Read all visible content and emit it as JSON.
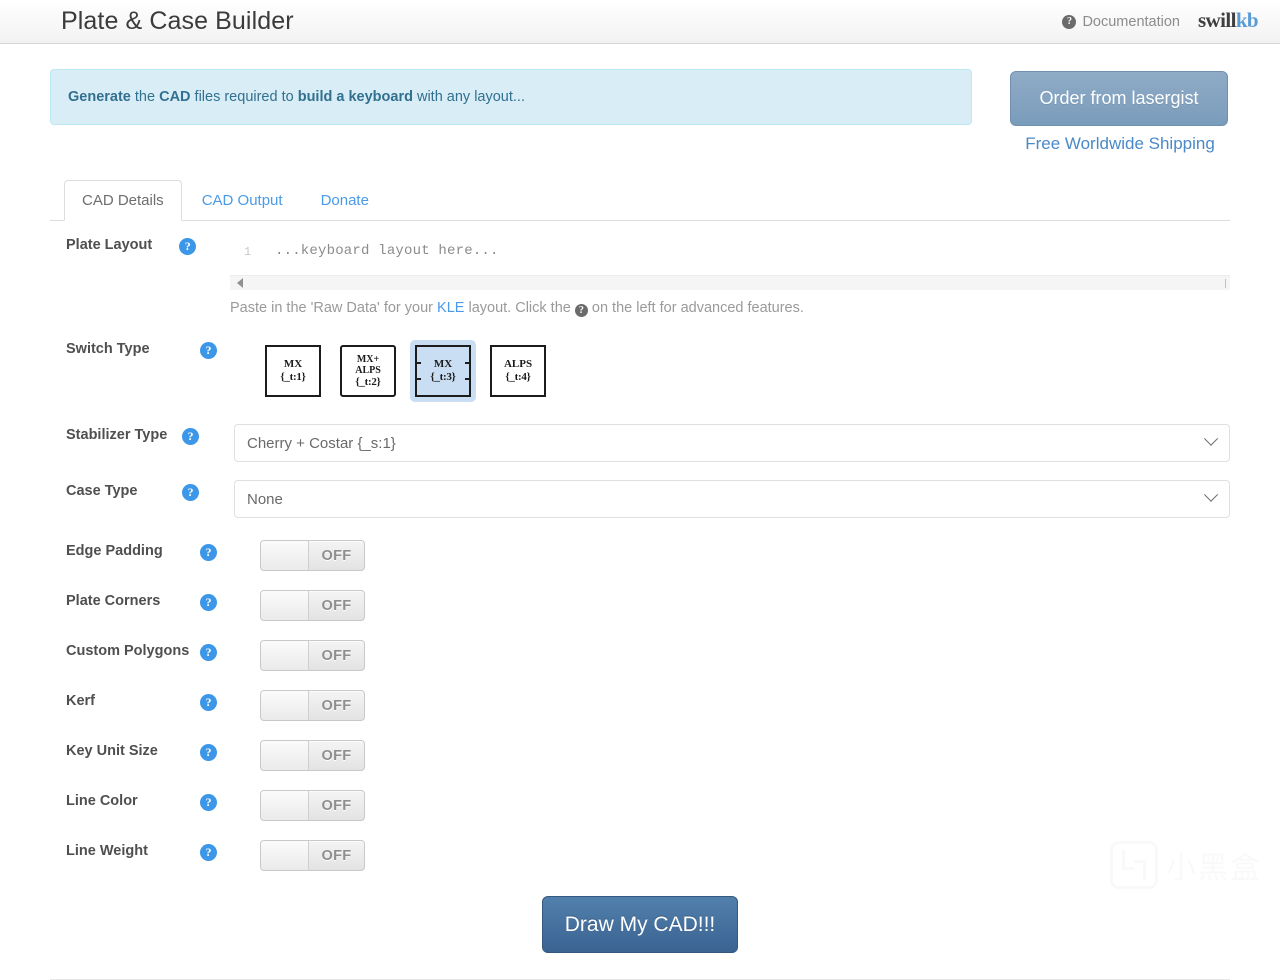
{
  "navbar": {
    "title": "Plate & Case Builder",
    "documentation_label": "Documentation",
    "help_glyph": "?",
    "logo_part1": "swill",
    "logo_part2": "kb"
  },
  "alert": {
    "word1": "Generate",
    "word2": " the ",
    "word3": "CAD",
    "word4": " files required to ",
    "word5": "build a keyboard",
    "word6": " with any layout...",
    "bg_color": "#d9edf7",
    "text_color": "#31708f"
  },
  "order": {
    "button_label": "Order from lasergist",
    "sub_label": "Free Worldwide Shipping",
    "link_color": "#4a89c8"
  },
  "tabs": [
    {
      "label": "CAD Details",
      "active": true
    },
    {
      "label": "CAD Output",
      "active": false
    },
    {
      "label": "Donate",
      "active": false
    }
  ],
  "form": {
    "plate_layout": {
      "label": "Plate Layout",
      "help_glyph": "?",
      "line_number": "1",
      "editor_value": "...keyboard layout here...",
      "help_text_pre": "Paste in the 'Raw Data' for your ",
      "help_link": "KLE",
      "help_text_mid": " layout. Click the ",
      "help_glyph_inline": "?",
      "help_text_post": " on the left for advanced features."
    },
    "switch_type": {
      "label": "Switch Type",
      "help_glyph": "?",
      "options": [
        {
          "name": "MX",
          "code": "{_t:1}",
          "style": "plain",
          "selected": false
        },
        {
          "name": "MX+ ALPS",
          "code": "{_t:2}",
          "style": "alps-notch",
          "selected": false
        },
        {
          "name": "MX",
          "code": "{_t:3}",
          "style": "mx-notch",
          "selected": true
        },
        {
          "name": "ALPS",
          "code": "{_t:4}",
          "style": "plain",
          "selected": false
        }
      ]
    },
    "stabilizer_type": {
      "label": "Stabilizer Type",
      "help_glyph": "?",
      "value": "Cherry + Costar {_s:1}"
    },
    "case_type": {
      "label": "Case Type",
      "help_glyph": "?",
      "value": "None"
    },
    "toggles": [
      {
        "label": "Edge Padding",
        "help_glyph": "?",
        "state": "OFF"
      },
      {
        "label": "Plate Corners",
        "help_glyph": "?",
        "state": "OFF"
      },
      {
        "label": "Custom Polygons",
        "help_glyph": "?",
        "state": "OFF"
      },
      {
        "label": "Kerf",
        "help_glyph": "?",
        "state": "OFF"
      },
      {
        "label": "Key Unit Size",
        "help_glyph": "?",
        "state": "OFF"
      },
      {
        "label": "Line Color",
        "help_glyph": "?",
        "state": "OFF"
      },
      {
        "label": "Line Weight",
        "help_glyph": "?",
        "state": "OFF"
      }
    ],
    "submit_label": "Draw My CAD!!!"
  },
  "watermark": {
    "text": "小黑盒"
  }
}
